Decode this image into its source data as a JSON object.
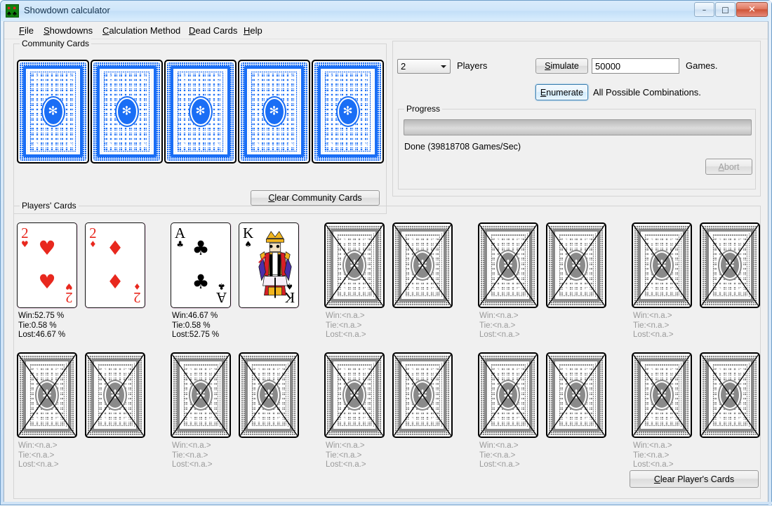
{
  "window": {
    "title": "Showdown calculator",
    "icon": "cards-icon",
    "controls": {
      "minimize": "–",
      "maximize": "□",
      "close": "✕"
    }
  },
  "menu": [
    {
      "label": "File",
      "mnemonic": "F",
      "rest": "ile"
    },
    {
      "label": "Showdowns",
      "mnemonic": "S",
      "rest": "howdowns"
    },
    {
      "label": "Calculation Method",
      "mnemonic": "C",
      "rest": "alculation Method"
    },
    {
      "label": "Dead Cards",
      "mnemonic": "D",
      "rest": "ead Cards"
    },
    {
      "label": "Help",
      "mnemonic": "H",
      "rest": "elp"
    }
  ],
  "community": {
    "title": "Community Cards",
    "clear_button": {
      "mnemonic": "C",
      "rest": "lear Community Cards"
    },
    "cards": [
      {
        "state": "back"
      },
      {
        "state": "back"
      },
      {
        "state": "back"
      },
      {
        "state": "back"
      },
      {
        "state": "back"
      }
    ]
  },
  "sim_panel": {
    "players_value": "2",
    "players_label": "Players",
    "simulate_button": {
      "mnemonic": "S",
      "rest": "imulate"
    },
    "games_value": "50000",
    "games_label": "Games.",
    "enumerate_button": {
      "mnemonic": "E",
      "rest": "numerate"
    },
    "enumerate_label": "All Possible Combinations.",
    "progress_title": "Progress",
    "progress_percent": 0,
    "progress_status": "Done (39818708 Games/Sec)",
    "abort_button": {
      "mnemonic": "A",
      "rest": "bort"
    }
  },
  "players_section": {
    "title": "Players' Cards",
    "clear_button": {
      "mnemonic": "C",
      "rest": "lear Player's Cards"
    },
    "odds_labels": {
      "win": "Win:",
      "tie": "Tie:",
      "lost": "Lost:"
    },
    "na_value": "<n.a.>",
    "players": [
      {
        "index": 1,
        "cards": [
          {
            "state": "face",
            "rank": "2",
            "suit": "♥",
            "color": "red"
          },
          {
            "state": "face",
            "rank": "2",
            "suit": "♦",
            "color": "red"
          }
        ],
        "win": "Win:52.75 %",
        "tie": "Tie:0.58 %",
        "lost": "Lost:46.67 %",
        "active": true
      },
      {
        "index": 2,
        "cards": [
          {
            "state": "face",
            "rank": "A",
            "suit": "♣",
            "color": "black"
          },
          {
            "state": "court",
            "rank": "K",
            "suit": "♠",
            "color": "black"
          }
        ],
        "win": "Win:46.67 %",
        "tie": "Tie:0.58 %",
        "lost": "Lost:52.75 %",
        "active": true
      },
      {
        "index": 3,
        "cards": [
          {
            "state": "disabled"
          },
          {
            "state": "disabled"
          }
        ],
        "win": "Win:<n.a.>",
        "tie": "Tie:<n.a.>",
        "lost": "Lost:<n.a.>",
        "active": false
      },
      {
        "index": 4,
        "cards": [
          {
            "state": "disabled"
          },
          {
            "state": "disabled"
          }
        ],
        "win": "Win:<n.a.>",
        "tie": "Tie:<n.a.>",
        "lost": "Lost:<n.a.>",
        "active": false
      },
      {
        "index": 5,
        "cards": [
          {
            "state": "disabled"
          },
          {
            "state": "disabled"
          }
        ],
        "win": "Win:<n.a.>",
        "tie": "Tie:<n.a.>",
        "lost": "Lost:<n.a.>",
        "active": false
      },
      {
        "index": 6,
        "cards": [
          {
            "state": "disabled"
          },
          {
            "state": "disabled"
          }
        ],
        "win": "Win:<n.a.>",
        "tie": "Tie:<n.a.>",
        "lost": "Lost:<n.a.>",
        "active": false
      },
      {
        "index": 7,
        "cards": [
          {
            "state": "disabled"
          },
          {
            "state": "disabled"
          }
        ],
        "win": "Win:<n.a.>",
        "tie": "Tie:<n.a.>",
        "lost": "Lost:<n.a.>",
        "active": false
      },
      {
        "index": 8,
        "cards": [
          {
            "state": "disabled"
          },
          {
            "state": "disabled"
          }
        ],
        "win": "Win:<n.a.>",
        "tie": "Tie:<n.a.>",
        "lost": "Lost:<n.a.>",
        "active": false
      },
      {
        "index": 9,
        "cards": [
          {
            "state": "disabled"
          },
          {
            "state": "disabled"
          }
        ],
        "win": "Win:<n.a.>",
        "tie": "Tie:<n.a.>",
        "lost": "Lost:<n.a.>",
        "active": false
      },
      {
        "index": 10,
        "cards": [
          {
            "state": "disabled"
          },
          {
            "state": "disabled"
          }
        ],
        "win": "Win:<n.a.>",
        "tie": "Tie:<n.a.>",
        "lost": "Lost:<n.a.>",
        "active": false
      }
    ]
  },
  "colors": {
    "card_back_blue": "#1a6ef5",
    "card_back_grey": "#8a8a8a",
    "red_suit": "#e8281e",
    "black_suit": "#000000",
    "window_bg": "#f0f0f0",
    "close_button": "#cf5438"
  }
}
